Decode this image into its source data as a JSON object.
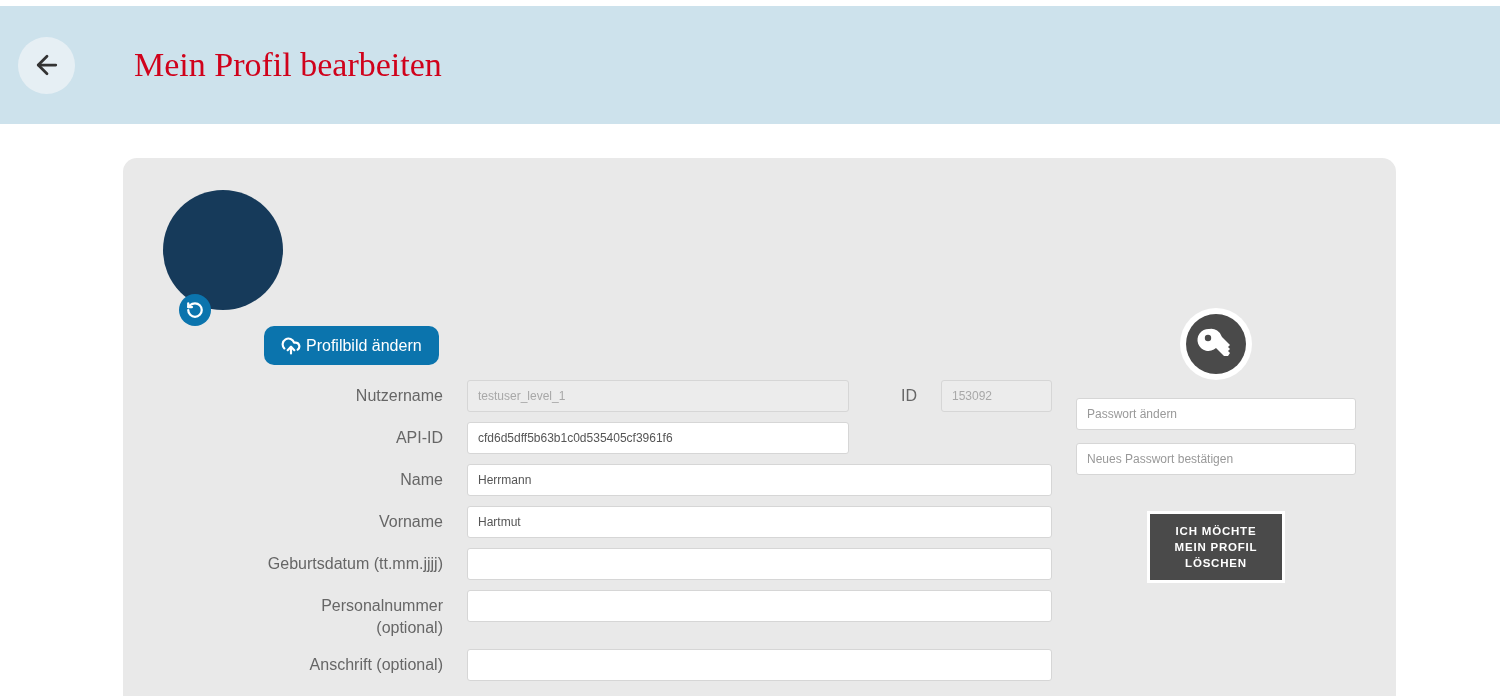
{
  "header": {
    "title": "Mein Profil bearbeiten"
  },
  "profile": {
    "change_photo_button": "Profilbild ändern"
  },
  "fields": [
    {
      "label": "Nutzername",
      "value": "testuser_level_1",
      "disabled": true,
      "kind": "half",
      "side": {
        "label": "ID",
        "value": "153092",
        "disabled": true
      }
    },
    {
      "label": "API-ID",
      "value": "cfd6d5dff5b63b1c0d535405cf3961f6",
      "disabled": false,
      "kind": "half"
    },
    {
      "label": "Name",
      "value": "Herrmann",
      "disabled": false,
      "kind": "full"
    },
    {
      "label": "Vorname",
      "value": "Hartmut",
      "disabled": false,
      "kind": "full"
    },
    {
      "label": "Geburtsdatum (tt.mm.jjjj)",
      "disabled": false,
      "kind": "full"
    },
    {
      "label": "Personalnummer (optional)",
      "disabled": false,
      "kind": "full"
    },
    {
      "label": "Anschrift (optional)",
      "disabled": false,
      "kind": "full"
    }
  ],
  "password": {
    "fields": [
      {
        "placeholder": "Passwort ändern"
      },
      {
        "placeholder": "Neues Passwort bestätigen"
      }
    ],
    "delete_button": "ICH MÖCHTE MEIN PROFIL LÖSCHEN"
  }
}
